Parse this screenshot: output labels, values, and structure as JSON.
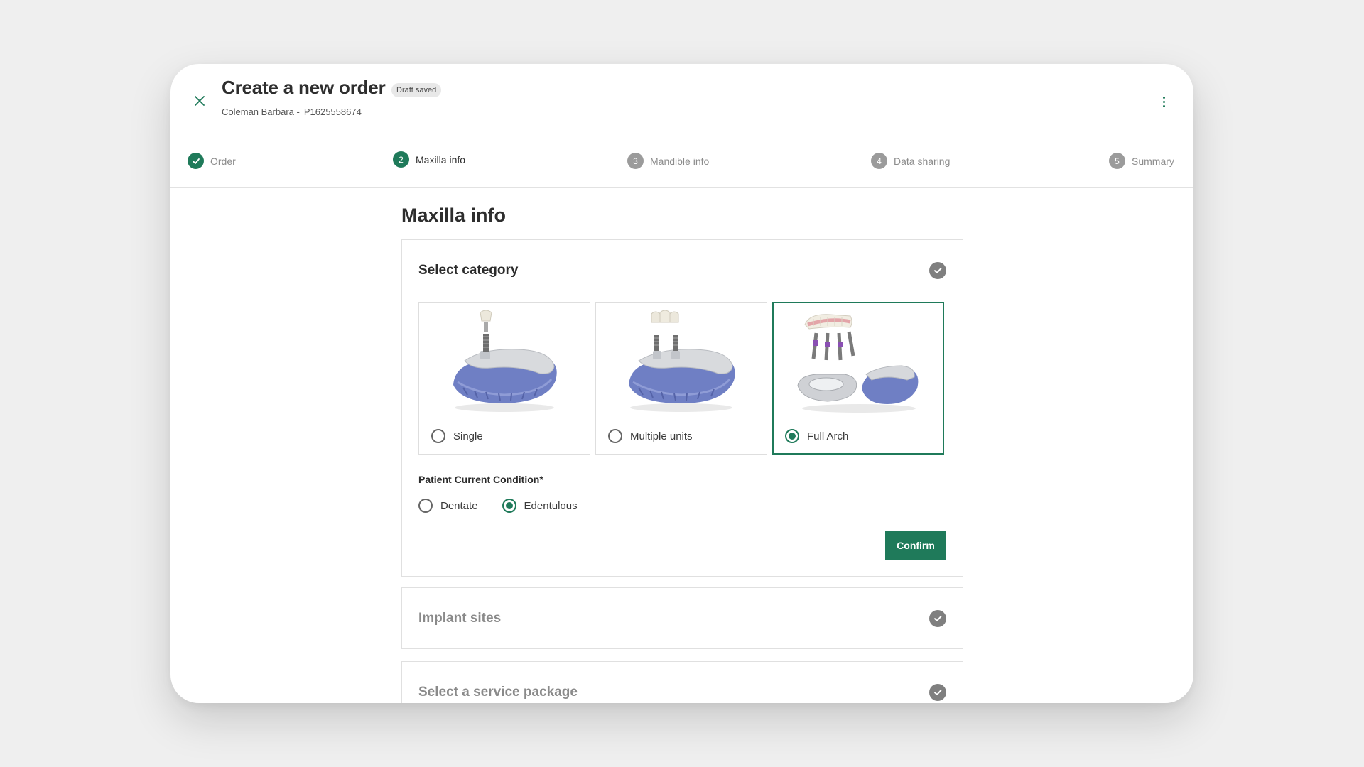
{
  "header": {
    "title": "Create a new order",
    "draft_badge": "Draft saved",
    "patient_name": "Coleman Barbara -",
    "patient_id": "P1625558674"
  },
  "steps": [
    {
      "number": "1",
      "label": "Order",
      "state": "done"
    },
    {
      "number": "2",
      "label": "Maxilla info",
      "state": "active"
    },
    {
      "number": "3",
      "label": "Mandible info",
      "state": "pending"
    },
    {
      "number": "4",
      "label": "Data sharing",
      "state": "pending"
    },
    {
      "number": "5",
      "label": "Summary",
      "state": "pending"
    }
  ],
  "page_title": "Maxilla info",
  "category_panel": {
    "title": "Select category",
    "options": [
      {
        "label": "Single",
        "selected": false
      },
      {
        "label": "Multiple units",
        "selected": false
      },
      {
        "label": "Full Arch",
        "selected": true
      }
    ],
    "condition_label": "Patient Current Condition*",
    "conditions": [
      {
        "label": "Dentate",
        "selected": false
      },
      {
        "label": "Edentulous",
        "selected": true
      }
    ],
    "confirm_label": "Confirm"
  },
  "implant_panel": {
    "title": "Implant sites"
  },
  "service_panel": {
    "title": "Select a service package"
  },
  "colors": {
    "accent": "#1f7a5a",
    "step_inactive": "#9b9b9b",
    "check_badge": "#7f7f7f"
  }
}
